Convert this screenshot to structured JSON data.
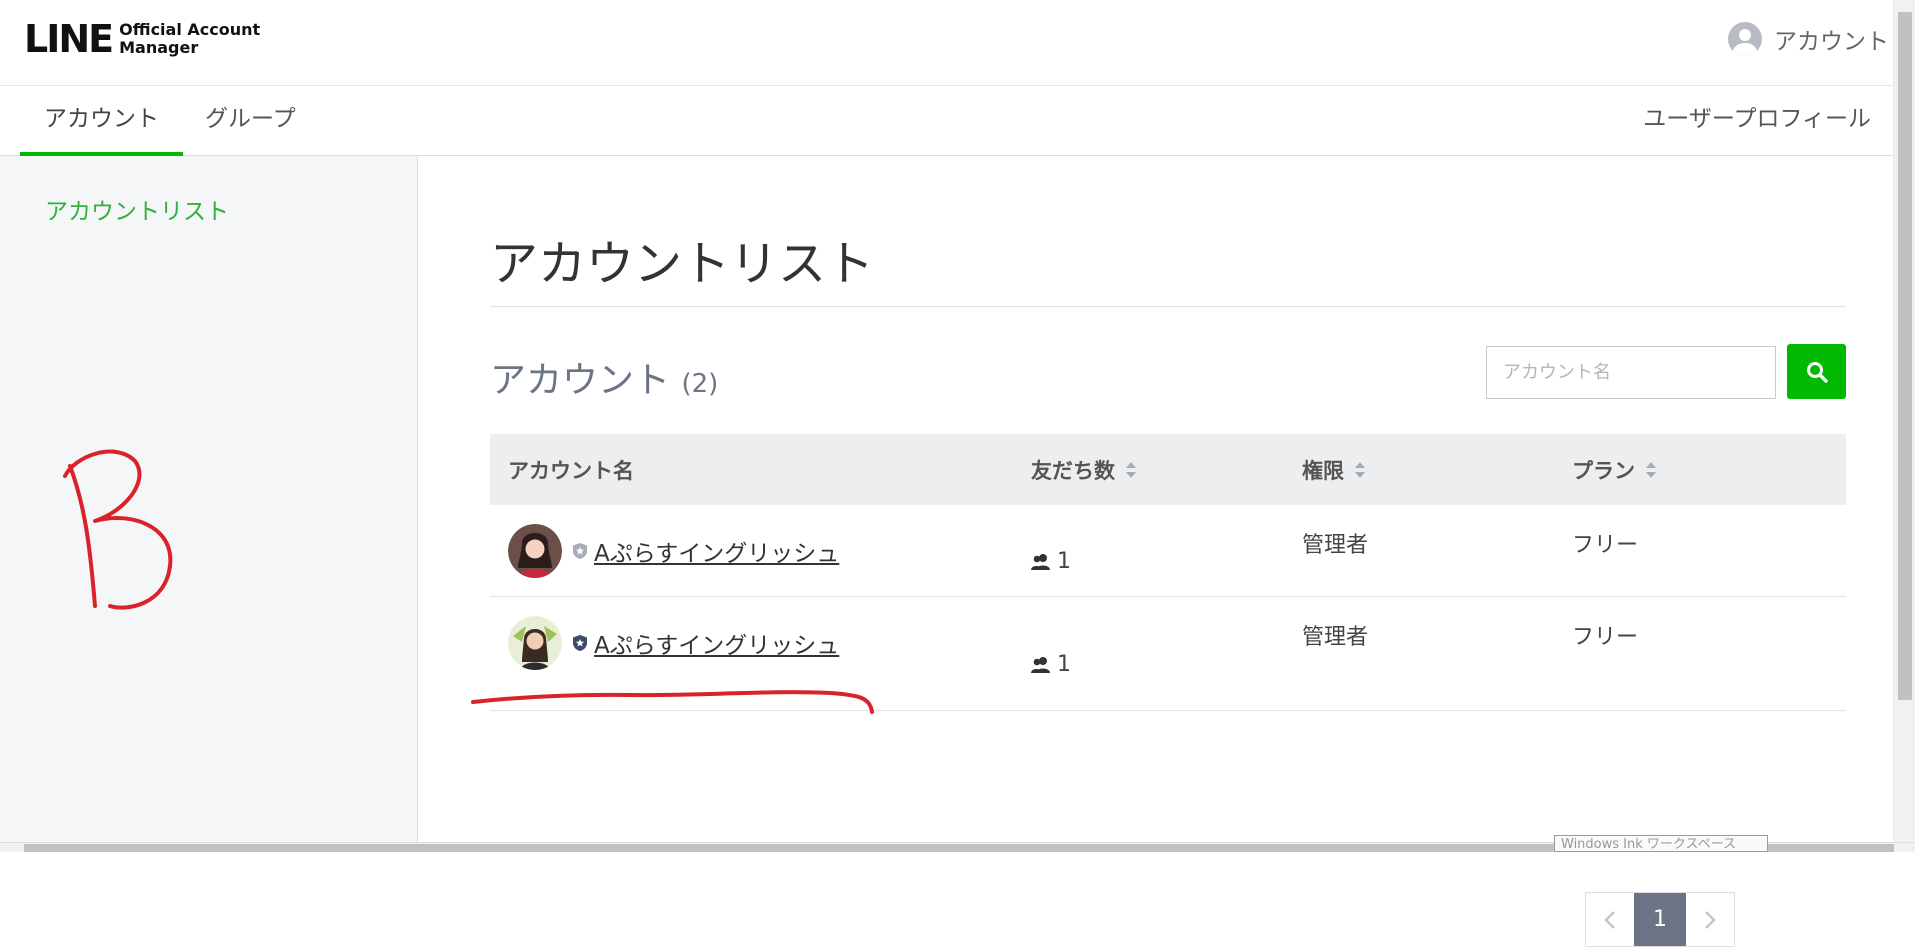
{
  "header": {
    "logo_main": "LINE",
    "logo_sub_line1": "Official Account",
    "logo_sub_line2": "Manager",
    "account_menu_label": "アカウント"
  },
  "nav": {
    "tabs": [
      {
        "label": "アカウント",
        "active": true
      },
      {
        "label": "グループ",
        "active": false
      }
    ],
    "right_link": "ユーザープロフィール"
  },
  "sidebar": {
    "items": [
      {
        "label": "アカウントリスト",
        "active": true
      }
    ]
  },
  "main": {
    "page_title": "アカウントリスト",
    "section_title": "アカウント",
    "section_count": "(2)",
    "search": {
      "placeholder": "アカウント名"
    },
    "table": {
      "headers": [
        "アカウント名",
        "友だち数",
        "権限",
        "プラン"
      ],
      "rows": [
        {
          "name": "Aぷらすイングリッシュ",
          "friends": "1",
          "role": "管理者",
          "plan": "フリー",
          "badge_color": "#a8aeb8"
        },
        {
          "name": "Aぷらすイングリッシュ",
          "friends": "1",
          "role": "管理者",
          "plan": "フリー",
          "badge_color": "#3d4a6b"
        }
      ]
    },
    "pagination": {
      "current": "1"
    }
  },
  "os": {
    "ink_tooltip": "Windows Ink ワークスペース"
  },
  "colors": {
    "brand_green": "#00b900",
    "link_green": "#2fb23a",
    "annotation_red": "#d9222a"
  }
}
